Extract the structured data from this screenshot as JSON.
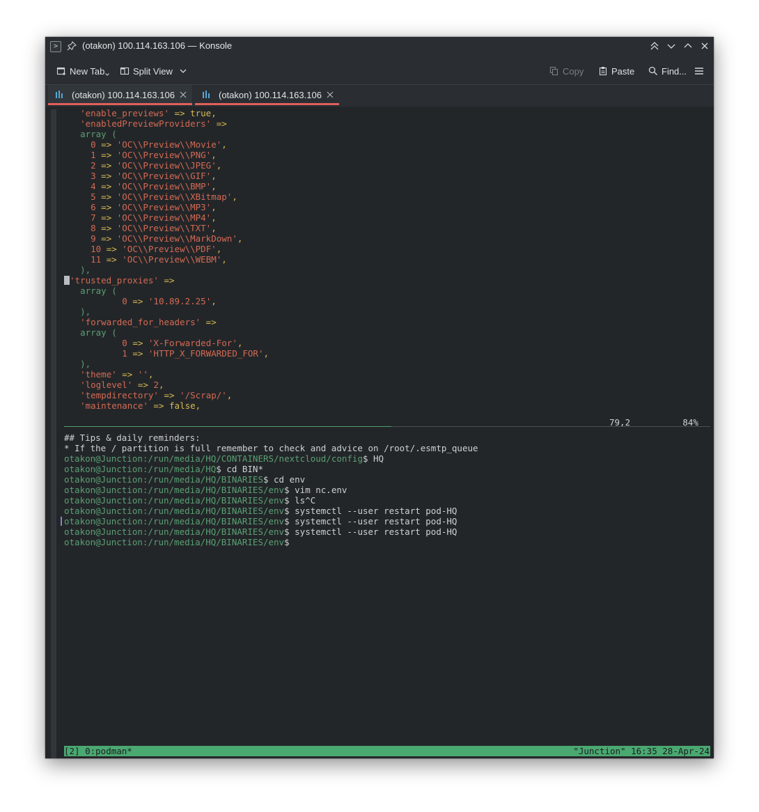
{
  "window": {
    "title": "(otakon) 100.114.163.106 — Konsole"
  },
  "toolbar": {
    "new_tab": "New Tab",
    "split_view": "Split View",
    "copy": "Copy",
    "paste": "Paste",
    "find": "Find..."
  },
  "tabs": [
    {
      "label": "(otakon) 100.114.163.106"
    },
    {
      "label": "(otakon) 100.114.163.106"
    }
  ],
  "vim": {
    "lines": [
      [
        "  ",
        "'enable_previews'",
        " => ",
        "true",
        ","
      ],
      [
        "  ",
        "'enabledPreviewProviders'",
        " =>"
      ],
      [
        "  ",
        "array ("
      ],
      [
        "    ",
        "0",
        " => ",
        "'OC\\\\Preview\\\\Movie'",
        ","
      ],
      [
        "    ",
        "1",
        " => ",
        "'OC\\\\Preview\\\\PNG'",
        ","
      ],
      [
        "    ",
        "2",
        " => ",
        "'OC\\\\Preview\\\\JPEG'",
        ","
      ],
      [
        "    ",
        "3",
        " => ",
        "'OC\\\\Preview\\\\GIF'",
        ","
      ],
      [
        "    ",
        "4",
        " => ",
        "'OC\\\\Preview\\\\BMP'",
        ","
      ],
      [
        "    ",
        "5",
        " => ",
        "'OC\\\\Preview\\\\XBitmap'",
        ","
      ],
      [
        "    ",
        "6",
        " => ",
        "'OC\\\\Preview\\\\MP3'",
        ","
      ],
      [
        "    ",
        "7",
        " => ",
        "'OC\\\\Preview\\\\MP4'",
        ","
      ],
      [
        "    ",
        "8",
        " => ",
        "'OC\\\\Preview\\\\TXT'",
        ","
      ],
      [
        "    ",
        "9",
        " => ",
        "'OC\\\\Preview\\\\MarkDown'",
        ","
      ],
      [
        "    ",
        "10",
        " => ",
        "'OC\\\\Preview\\\\PDF'",
        ","
      ],
      [
        "    ",
        "11",
        " => ",
        "'OC\\\\Preview\\\\WEBM'",
        ","
      ],
      [
        "  ",
        "),"
      ],
      [
        "",
        "'trusted_proxies'",
        " =>"
      ],
      [
        "  ",
        "array ("
      ],
      [
        "          ",
        "0",
        " => ",
        "'10.89.2.25'",
        ","
      ],
      [
        "  ",
        "),"
      ],
      [
        "  ",
        "'forwarded_for_headers'",
        " =>"
      ],
      [
        "  ",
        "array ("
      ],
      [
        "          ",
        "0",
        " => ",
        "'X-Forwarded-For'",
        ","
      ],
      [
        "          ",
        "1",
        " => ",
        "'HTTP_X_FORWARDED_FOR'",
        ","
      ],
      [
        "  ",
        "),"
      ],
      [
        "  ",
        "'theme'",
        " => ",
        "''",
        ","
      ],
      [
        "  ",
        "'loglevel'",
        " => ",
        "2",
        ","
      ],
      [
        "  ",
        "'tempdirectory'",
        " => ",
        "'/Scrap/'",
        ","
      ],
      [
        "  ",
        "'maintenance'",
        " => ",
        "false",
        ","
      ]
    ],
    "ruler": "79,2          84%"
  },
  "shell": {
    "header": "## Tips & daily reminders:",
    "tip": "* If the / partition is full remember to check and advice on /root/.esmtp_queue",
    "commands": [
      {
        "user": "otakon@Junction",
        "path": ":/run/media/HQ/CONTAINERS/nextcloud/config",
        "cmd": "$ HQ"
      },
      {
        "user": "otakon@Junction",
        "path": ":/run/media/HQ",
        "cmd": "$ cd BIN*"
      },
      {
        "user": "otakon@Junction",
        "path": ":/run/media/HQ/BINARIES",
        "cmd": "$ cd env"
      },
      {
        "user": "otakon@Junction",
        "path": ":/run/media/HQ/BINARIES/env",
        "cmd": "$ vim nc.env"
      },
      {
        "user": "otakon@Junction",
        "path": ":/run/media/HQ/BINARIES/env",
        "cmd": "$ ls^C"
      },
      {
        "user": "otakon@Junction",
        "path": ":/run/media/HQ/BINARIES/env",
        "cmd": "$ systemctl --user restart pod-HQ"
      },
      {
        "user": "otakon@Junction",
        "path": ":/run/media/HQ/BINARIES/env",
        "cmd": "$ systemctl --user restart pod-HQ"
      },
      {
        "user": "otakon@Junction",
        "path": ":/run/media/HQ/BINARIES/env",
        "cmd": "$ systemctl --user restart pod-HQ"
      },
      {
        "user": "otakon@Junction",
        "path": ":/run/media/HQ/BINARIES/env",
        "cmd": "$"
      }
    ]
  },
  "tmux": {
    "left": "[2] 0:podman*",
    "right": "\"Junction\" 16:35 28-Apr-24"
  },
  "colors": {
    "accent_tab": "#e0605c",
    "status_green": "#4aa871",
    "prompt_green": "#5aa074"
  }
}
